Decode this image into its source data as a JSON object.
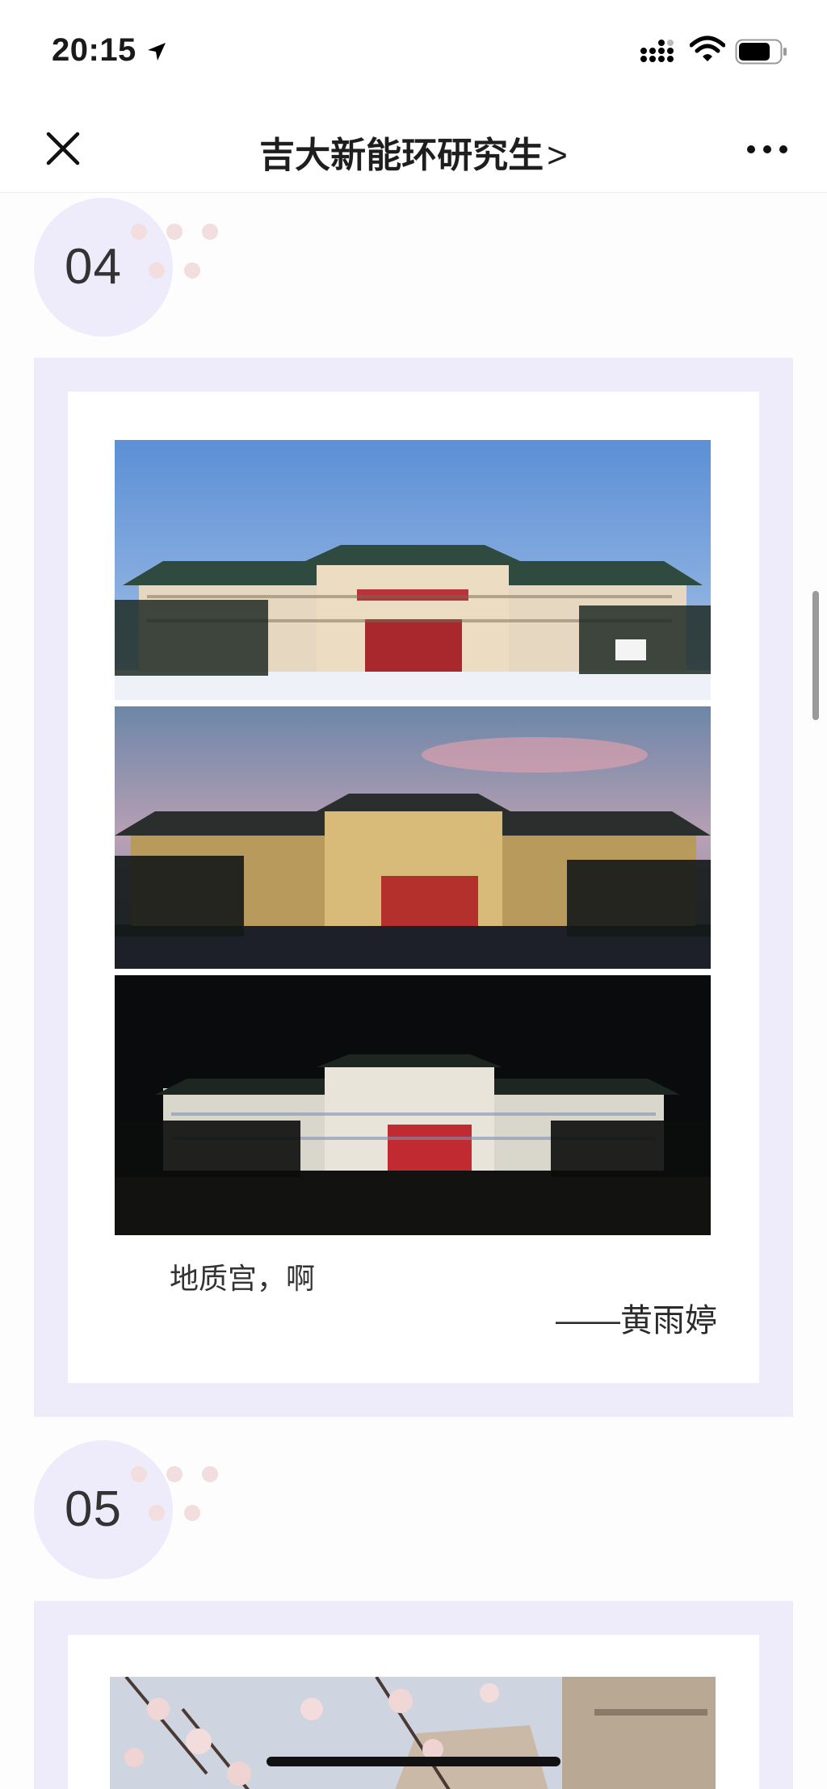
{
  "status_bar": {
    "time": "20:15",
    "icons": [
      "location-arrow-icon",
      "cellular-signal-icon",
      "wifi-icon",
      "battery-icon"
    ]
  },
  "nav": {
    "title": "吉大新能环研究生",
    "title_chevron": ">",
    "close_icon": "close-icon",
    "more_icon": "more-icon"
  },
  "sections": [
    {
      "number": "04",
      "photos": [
        "building-daytime-photo",
        "building-dusk-photo",
        "building-night-photo"
      ],
      "caption": "地质宫，啊",
      "author": "——黄雨婷"
    },
    {
      "number": "05",
      "photos": [
        "cherry-blossom-photo"
      ]
    }
  ],
  "colors": {
    "accent_lavender": "#eeebfa",
    "dot_pink": "#f2dede",
    "text_dark": "#1e1e1e"
  }
}
